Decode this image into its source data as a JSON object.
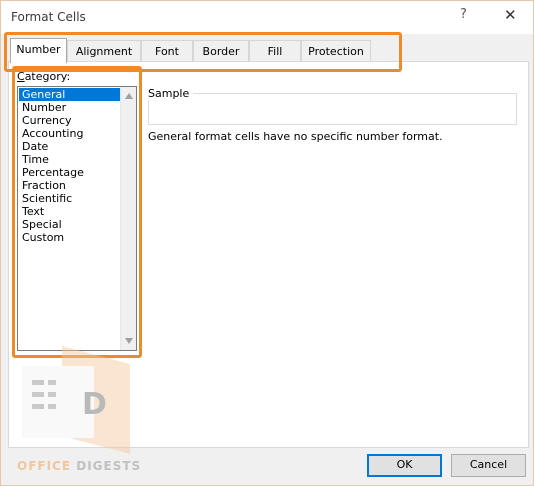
{
  "window": {
    "title": "Format Cells",
    "help": "?",
    "close": "✕"
  },
  "tabs": [
    {
      "label": "Number",
      "active": true
    },
    {
      "label": "Alignment",
      "active": false
    },
    {
      "label": "Font",
      "active": false
    },
    {
      "label": "Border",
      "active": false
    },
    {
      "label": "Fill",
      "active": false
    },
    {
      "label": "Protection",
      "active": false
    }
  ],
  "category": {
    "label_underline": "C",
    "label_rest": "ategory:",
    "items": [
      "General",
      "Number",
      "Currency",
      "Accounting",
      "Date",
      "Time",
      "Percentage",
      "Fraction",
      "Scientific",
      "Text",
      "Special",
      "Custom"
    ],
    "selected": "General"
  },
  "sample": {
    "label": "Sample"
  },
  "description": "General format cells have no specific number format.",
  "buttons": {
    "ok": "OK",
    "cancel": "Cancel"
  },
  "watermark": {
    "logo_letter": "D",
    "text_a": "OFFICE ",
    "text_b": "DIGESTS"
  },
  "colors": {
    "highlight": "#ef8a2a",
    "selection": "#0078d7"
  }
}
